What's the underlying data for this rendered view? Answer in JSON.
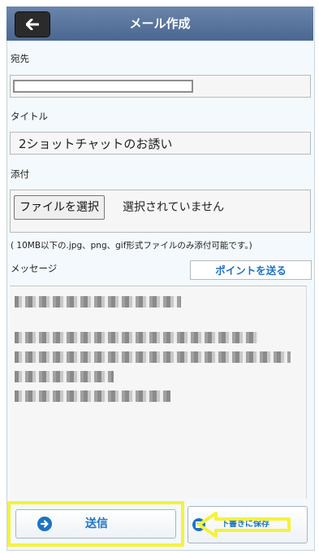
{
  "header": {
    "title": "メール作成",
    "back_icon": "back-arrow-icon"
  },
  "form": {
    "to_label": "宛先",
    "to_value": "",
    "title_label": "タイトル",
    "title_value": "2ショットチャットのお誘い",
    "attachment_label": "添付",
    "file_button_label": "ファイルを選択",
    "file_status": "選択されていません",
    "attachment_note": "( 10MB以下の.jpg、png、gif形式ファイルのみ添付可能です。)",
    "message_label": "メッセージ",
    "point_button_label": "ポイントを送る"
  },
  "actions": {
    "send_label": "送信",
    "draft_label": "下書きに保存"
  },
  "colors": {
    "header_top": "#6b85ab",
    "header_bottom": "#4a6791",
    "accent_blue": "#1d73c4",
    "highlight_yellow": "#f5f23a"
  }
}
